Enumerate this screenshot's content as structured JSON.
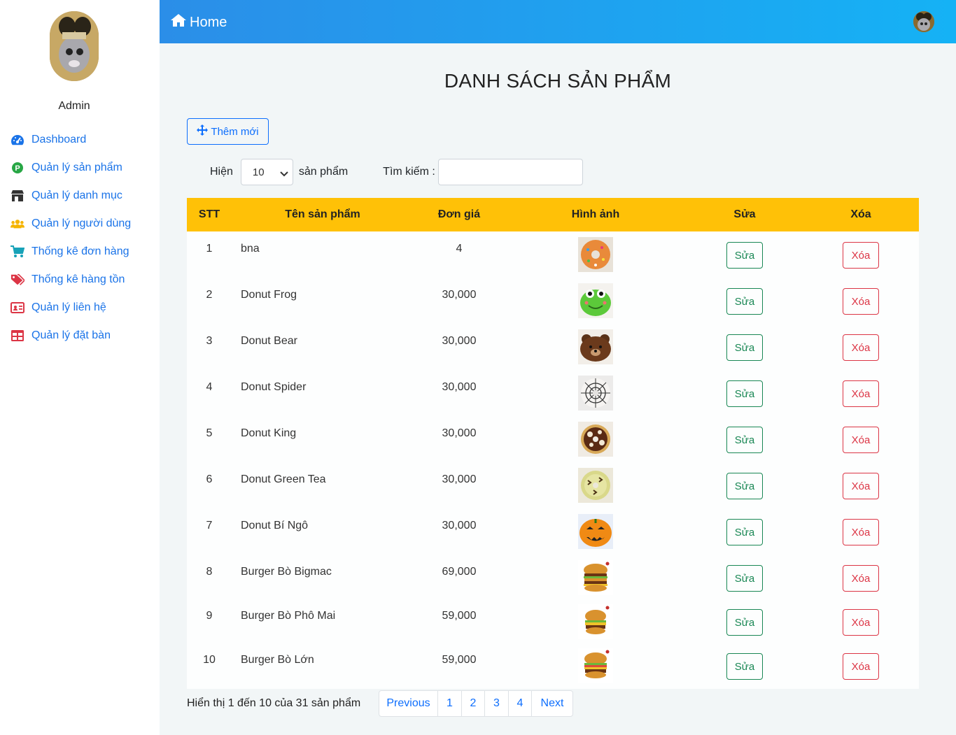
{
  "sidebar": {
    "user_name": "Admin",
    "items": [
      {
        "label": "Dashboard",
        "icon": "dashboard-gauge-icon",
        "color": "#1a73e8"
      },
      {
        "label": "Quản lý sản phẩm",
        "icon": "product-p-badge-icon",
        "color": "#28a745"
      },
      {
        "label": "Quản lý danh mục",
        "icon": "store-icon",
        "color": "#333333"
      },
      {
        "label": "Quản lý người dùng",
        "icon": "users-icon",
        "color": "#f5b400"
      },
      {
        "label": "Thống kê đơn hàng",
        "icon": "cart-icon",
        "color": "#17a2b8"
      },
      {
        "label": "Thống kê hàng tồn",
        "icon": "tags-icon",
        "color": "#dc3545"
      },
      {
        "label": "Quản lý liên hệ",
        "icon": "contact-card-icon",
        "color": "#dc3545"
      },
      {
        "label": "Quản lý đặt bàn",
        "icon": "table-grid-icon",
        "color": "#dc3545"
      }
    ]
  },
  "header": {
    "home_label": "Home",
    "home_icon": "home-icon"
  },
  "page": {
    "title": "DANH SÁCH SẢN PHẨM",
    "add_button": "Thêm mới",
    "show_label": "Hiện",
    "page_size": "10",
    "unit_label": "sản phẩm",
    "search_label": "Tìm kiếm :",
    "search_value": ""
  },
  "table": {
    "headers": [
      "STT",
      "Tên sản phẩm",
      "Đơn giá",
      "Hình ảnh",
      "Sửa",
      "Xóa"
    ],
    "edit_label": "Sửa",
    "delete_label": "Xóa",
    "rows": [
      {
        "stt": "1",
        "name": "bna",
        "price": "4",
        "image": "sprinkle-donut"
      },
      {
        "stt": "2",
        "name": "Donut Frog",
        "price": "30,000",
        "image": "frog-donut"
      },
      {
        "stt": "3",
        "name": "Donut Bear",
        "price": "30,000",
        "image": "bear-donut"
      },
      {
        "stt": "4",
        "name": "Donut Spider",
        "price": "30,000",
        "image": "spider-donut"
      },
      {
        "stt": "5",
        "name": "Donut King",
        "price": "30,000",
        "image": "king-donut"
      },
      {
        "stt": "6",
        "name": "Donut Green Tea",
        "price": "30,000",
        "image": "greentea-donut"
      },
      {
        "stt": "7",
        "name": "Donut Bí Ngô",
        "price": "30,000",
        "image": "pumpkin-donut"
      },
      {
        "stt": "8",
        "name": "Burger Bò Bigmac",
        "price": "69,000",
        "image": "bigmac-burger"
      },
      {
        "stt": "9",
        "name": "Burger Bò Phô Mai",
        "price": "59,000",
        "image": "cheese-burger"
      },
      {
        "stt": "10",
        "name": "Burger Bò Lớn",
        "price": "59,000",
        "image": "big-burger"
      }
    ]
  },
  "footer": {
    "info": "Hiển thị 1 đến 10 của 31 sản phẩm",
    "pagination": [
      "Previous",
      "1",
      "2",
      "3",
      "4",
      "Next"
    ]
  }
}
